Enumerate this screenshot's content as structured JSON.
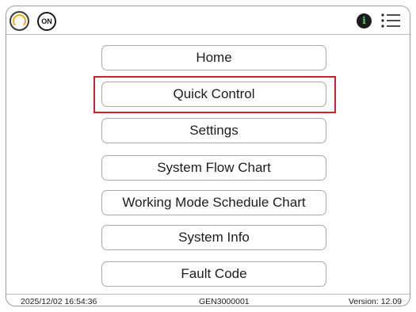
{
  "topbar": {
    "on_label": "ON",
    "info_label": "i",
    "icons": [
      "power-status-icon",
      "on-status-icon",
      "info-icon",
      "menu-list-icon"
    ],
    "colors": {
      "power_arc": "#f0a81c",
      "info_glyph": "#5fd15f"
    }
  },
  "menu": {
    "items": [
      {
        "label": "Home"
      },
      {
        "label": "Quick Control"
      },
      {
        "label": "Settings"
      },
      {
        "label": "System Flow Chart"
      },
      {
        "label": "Working Mode Schedule Chart"
      },
      {
        "label": "System Info"
      },
      {
        "label": "Fault Code"
      }
    ],
    "highlighted_item": "Quick Control",
    "highlight_color": "#d4202a"
  },
  "footer": {
    "datetime": "2025/12/02 16:54:36",
    "device_id": "GEN3000001",
    "version": "Version: 12.09"
  }
}
